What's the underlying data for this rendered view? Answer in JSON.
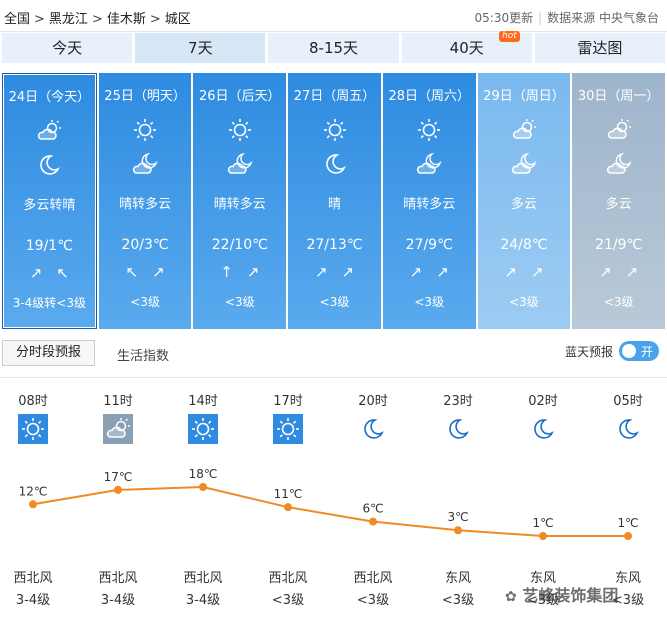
{
  "breadcrumb": [
    "全国",
    "黑龙江",
    "佳木斯",
    "城区"
  ],
  "update_time": "05:30更新",
  "source": "数据来源 中央气象台",
  "tabs": [
    {
      "label": "今天",
      "active": false
    },
    {
      "label": "7天",
      "active": true
    },
    {
      "label": "8-15天",
      "active": false
    },
    {
      "label": "40天",
      "active": false,
      "badge": "hot"
    },
    {
      "label": "雷达图",
      "active": false
    }
  ],
  "days": [
    {
      "date": "24日（今天）",
      "icon_day": "partly-cloudy-icon",
      "icon_night": "moon-icon",
      "desc": "多云转晴",
      "temp": "19/1℃",
      "wind_dirs": [
        "↗",
        "↖"
      ],
      "wind": "3-4级转<3级",
      "style": "active"
    },
    {
      "date": "25日（明天）",
      "icon_day": "sun-icon",
      "icon_night": "cloudy-night-icon",
      "desc": "晴转多云",
      "temp": "20/3℃",
      "wind_dirs": [
        "↖",
        "↗"
      ],
      "wind": "<3级",
      "style": ""
    },
    {
      "date": "26日（后天）",
      "icon_day": "sun-icon",
      "icon_night": "cloudy-night-icon",
      "desc": "晴转多云",
      "temp": "22/10℃",
      "wind_dirs": [
        "↑",
        "↗"
      ],
      "wind": "<3级",
      "style": ""
    },
    {
      "date": "27日（周五）",
      "icon_day": "sun-icon",
      "icon_night": "moon-icon",
      "desc": "晴",
      "temp": "27/13℃",
      "wind_dirs": [
        "↗",
        "↗"
      ],
      "wind": "<3级",
      "style": ""
    },
    {
      "date": "28日（周六）",
      "icon_day": "sun-icon",
      "icon_night": "cloudy-night-icon",
      "desc": "晴转多云",
      "temp": "27/9℃",
      "wind_dirs": [
        "↗",
        "↗"
      ],
      "wind": "<3级",
      "style": ""
    },
    {
      "date": "29日（周日）",
      "icon_day": "partly-cloudy-icon",
      "icon_night": "cloudy-night-icon",
      "desc": "多云",
      "temp": "24/8℃",
      "wind_dirs": [
        "↗",
        "↗"
      ],
      "wind": "<3级",
      "style": "weekend"
    },
    {
      "date": "30日（周一）",
      "icon_day": "partly-cloudy-icon",
      "icon_night": "cloudy-night-icon",
      "desc": "多云",
      "temp": "21/9℃",
      "wind_dirs": [
        "↗",
        "↗"
      ],
      "wind": "<3级",
      "style": "last"
    }
  ],
  "subtabs": {
    "hourly": "分时段预报",
    "life": "生活指数"
  },
  "blue_alert": {
    "label": "蓝天预报",
    "toggle": "开"
  },
  "hourly": [
    {
      "time": "08时",
      "icon": "sun-icon",
      "temp": 12,
      "temp_label": "12℃",
      "wind_dir": "西北风",
      "wind": "3-4级"
    },
    {
      "time": "11时",
      "icon": "partly-cloudy-icon",
      "temp": 17,
      "temp_label": "17℃",
      "wind_dir": "西北风",
      "wind": "3-4级"
    },
    {
      "time": "14时",
      "icon": "sun-icon",
      "temp": 18,
      "temp_label": "18℃",
      "wind_dir": "西北风",
      "wind": "3-4级"
    },
    {
      "time": "17时",
      "icon": "sun-icon",
      "temp": 11,
      "temp_label": "11℃",
      "wind_dir": "西北风",
      "wind": "<3级"
    },
    {
      "time": "20时",
      "icon": "moon-icon",
      "temp": 6,
      "temp_label": "6℃",
      "wind_dir": "西北风",
      "wind": "<3级"
    },
    {
      "time": "23时",
      "icon": "moon-icon",
      "temp": 3,
      "temp_label": "3℃",
      "wind_dir": "东风",
      "wind": "<3级"
    },
    {
      "time": "02时",
      "icon": "moon-icon",
      "temp": 1,
      "temp_label": "1℃",
      "wind_dir": "东风",
      "wind": "<3级"
    },
    {
      "time": "05时",
      "icon": "moon-icon",
      "temp": 1,
      "temp_label": "1℃",
      "wind_dir": "东风",
      "wind": "<3级"
    }
  ],
  "line_color": "#f08a24",
  "watermark": "艺峰装饰集团"
}
